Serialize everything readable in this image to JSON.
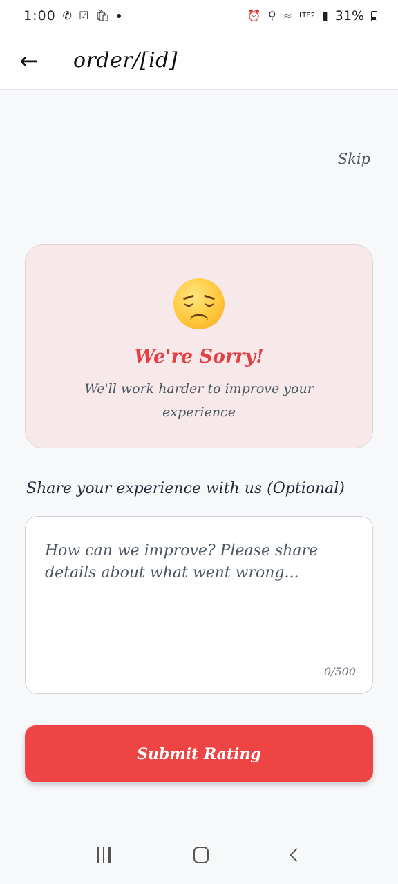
{
  "status_bar": {
    "time": "1:00",
    "battery": "31%",
    "network": "LTE2"
  },
  "app_bar": {
    "title": "order/[id]"
  },
  "skip_label": "Skip",
  "sorry_card": {
    "title": "We're Sorry!",
    "subtitle": "We'll work harder to improve your experience",
    "emoji": "disappointed-face"
  },
  "feedback": {
    "label": "Share your experience with us (Optional)",
    "placeholder": "How can we improve? Please share details about what went wrong...",
    "value": "",
    "char_count": "0/500"
  },
  "submit_label": "Submit Rating",
  "colors": {
    "accent": "#ef4444",
    "card_bg": "#f7e9ea",
    "title_red": "#e53e43"
  }
}
